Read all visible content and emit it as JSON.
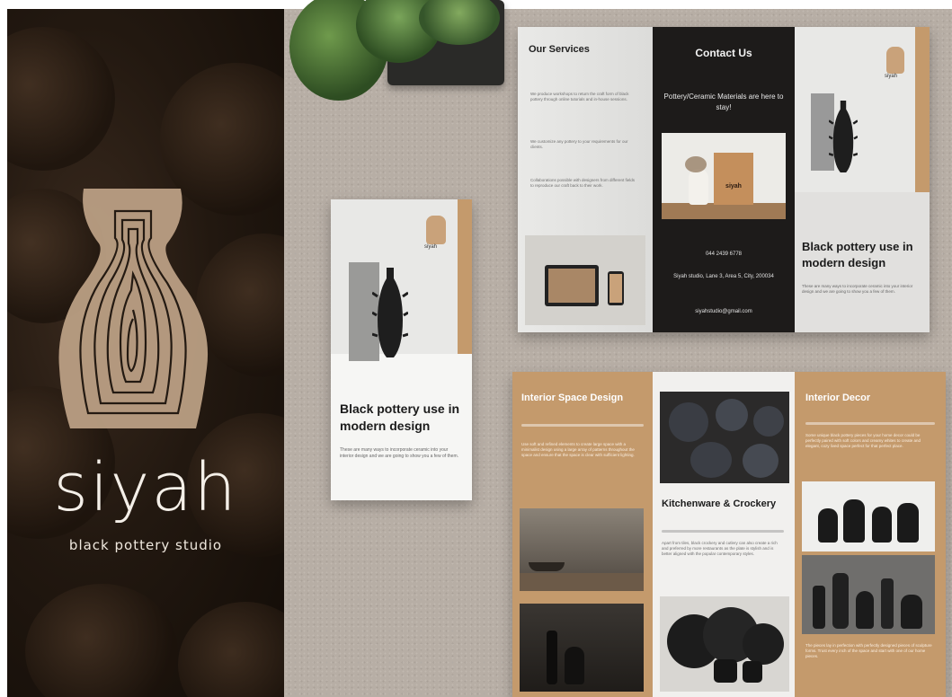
{
  "brand": {
    "title": "siyah",
    "subtitle": "black pottery studio"
  },
  "small_brochure": {
    "logo_text": "siyah",
    "heading": "Black pottery use in modern design",
    "body": "These are many ways to incorporate ceramic into your interior design and we are going to show you a few of them."
  },
  "top_brochure": {
    "services_title": "Our Services",
    "services_items": [
      "We produce workshops to return the craft form of black pottery through online tutorials and in-house sessions.",
      "We customize any pottery to your requirements for our clients.",
      "Collaborations possible with designers from different fields to reproduce our craft back to their work."
    ],
    "contact_title": "Contact Us",
    "contact_tagline": "Pottery/Ceramic Materials are here to stay!",
    "bag_label": "siyah",
    "phone": "044 2439 6778",
    "address": "Siyah studio, Lane 3, Area 5, City, 200034",
    "email": "siyahstudio@gmail.com",
    "logo_text": "siyah",
    "heading": "Black pottery use in modern design",
    "body": "These are many ways to incorporate ceramic into your interior design and we are going to show you a few of them."
  },
  "bottom_brochure": {
    "left_title": "Interior Space Design",
    "left_body": "Use soft and refined elements to create large space with a minimalist design using a large array of patterns throughout the space and ensure that the space is clear with sufficient lighting.",
    "mid_title": "Kitchenware & Crockery",
    "mid_body": "Apart from tiles, black crockery and cutlery can also create a rich and preferred by more restaurants as the plate is stylish and is better aligned with the popular contemporary styles.",
    "right_title": "Interior Decor",
    "right_body": "Some unique black pottery pieces for your home decor could be perfectly paired with soft colors and creamy whites to create and elegant, cozy lived space perfect for that perfect place.",
    "right_footer": "The pieces lay in perfection with perfectly designed pieces of sculpture forms. Trust every inch of the space and start with one of our home pieces."
  },
  "colors": {
    "tan": "#c49a6c",
    "black_panel": "#1d1b1a",
    "light_panel": "#e4e4e2",
    "surface": "#b7aea5"
  }
}
